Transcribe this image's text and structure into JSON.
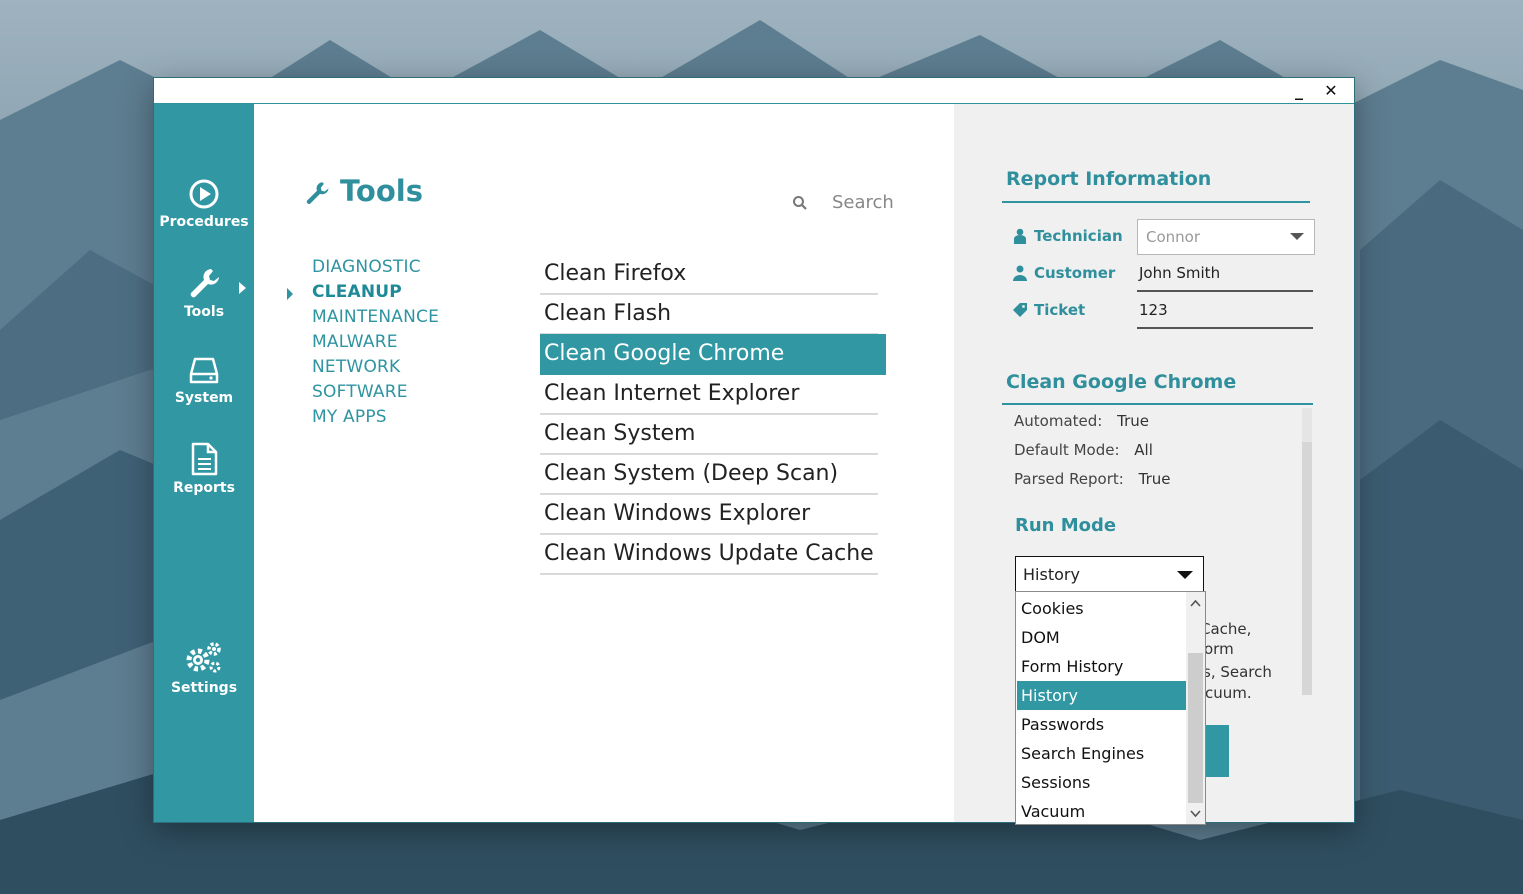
{
  "window": {
    "minimize_label": "_",
    "close_label": "✕"
  },
  "sidebar": {
    "items": [
      {
        "label": "Procedures",
        "icon": "play-circle-icon"
      },
      {
        "label": "Tools",
        "icon": "wrench-icon"
      },
      {
        "label": "System",
        "icon": "drive-icon"
      },
      {
        "label": "Reports",
        "icon": "document-icon"
      },
      {
        "label": "Settings",
        "icon": "gears-icon"
      }
    ],
    "active": "Tools"
  },
  "main": {
    "title": "Tools",
    "search_placeholder": "Search",
    "categories": [
      "DIAGNOSTIC",
      "CLEANUP",
      "MAINTENANCE",
      "MALWARE",
      "NETWORK",
      "SOFTWARE",
      "MY APPS"
    ],
    "active_category": "CLEANUP",
    "tools": [
      "Clean Firefox",
      "Clean Flash",
      "Clean Google Chrome",
      "Clean Internet Explorer",
      "Clean System",
      "Clean System (Deep Scan)",
      "Clean Windows Explorer",
      "Clean Windows Update Cache"
    ],
    "selected_tool": "Clean Google Chrome"
  },
  "report": {
    "title": "Report Information",
    "technician_label": "Technician",
    "technician_value": "Connor",
    "customer_label": "Customer",
    "customer_value": "John Smith",
    "ticket_label": "Ticket",
    "ticket_value": "123"
  },
  "details": {
    "title": "Clean Google Chrome",
    "automated_label": "Automated:",
    "automated_value": "True",
    "default_mode_label": "Default Mode:",
    "default_mode_value": "All",
    "parsed_report_label": "Parsed Report:",
    "parsed_report_value": "True",
    "run_mode_title": "Run Mode",
    "run_mode_value": "History",
    "partial_description": [
      "Cache,",
      "orm",
      "s, Search",
      "cuum."
    ],
    "run_mode_options": [
      "Cookies",
      "DOM",
      "Form History",
      "History",
      "Passwords",
      "Search Engines",
      "Sessions",
      "Vacuum"
    ]
  },
  "colors": {
    "accent": "#3097a3",
    "accent_text": "#2f8f9c"
  }
}
